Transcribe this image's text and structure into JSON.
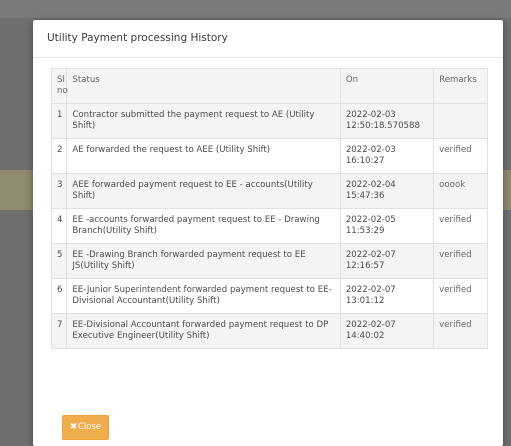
{
  "modal": {
    "title": "Utility Payment processing History",
    "close_icon": "times-icon",
    "close_label": "Close",
    "colors": {
      "button": "#f0ad4e"
    }
  },
  "table": {
    "headers": {
      "sl_line1": "Sl",
      "sl_line2": "no",
      "status": "Status",
      "on": "On",
      "remarks": "Remarks"
    },
    "rows": [
      {
        "sl": "1",
        "status": "Contractor submitted the payment request to AE (Utility Shift)",
        "on_date": "2022-02-03",
        "on_time": "12:50:18.570588",
        "remarks": ""
      },
      {
        "sl": "2",
        "status": "AE forwarded the request to AEE (Utility Shift)",
        "on_date": "2022-02-03",
        "on_time": "16:10:27",
        "remarks": "verified"
      },
      {
        "sl": "3",
        "status": "AEE forwarded payment request to EE - accounts(Utility Shift)",
        "on_date": "2022-02-04",
        "on_time": "15:47:36",
        "remarks": "ooook"
      },
      {
        "sl": "4",
        "status": "EE -accounts forwarded payment request to EE - Drawing Branch(Utility Shift)",
        "on_date": "2022-02-05",
        "on_time": "11:53:29",
        "remarks": "verified"
      },
      {
        "sl": "5",
        "status": "EE -Drawing Branch forwarded payment request to EE JS(Utility Shift)",
        "on_date": "2022-02-07",
        "on_time": "12:16:57",
        "remarks": "verified"
      },
      {
        "sl": "6",
        "status": "EE-Junior Superintendent forwarded payment request to EE-Divisional Accountant(Utility Shift)",
        "on_date": "2022-02-07",
        "on_time": "13:01:12",
        "remarks": "verified"
      },
      {
        "sl": "7",
        "status": "EE-Divisional Accountant forwarded payment request to DP Executive Engineer(Utility Shift)",
        "on_date": "2022-02-07",
        "on_time": "14:40:02",
        "remarks": "verified"
      }
    ]
  }
}
